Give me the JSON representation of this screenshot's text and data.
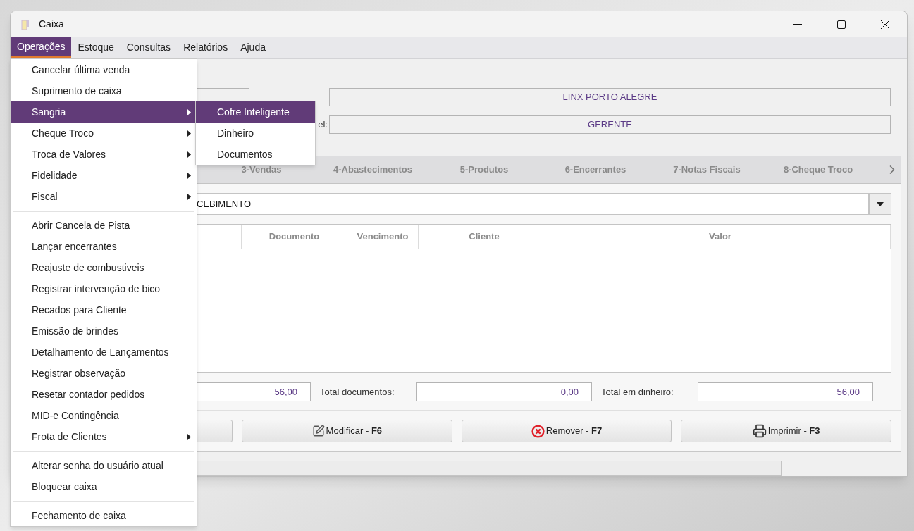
{
  "window": {
    "title": "Caixa"
  },
  "menubar": [
    {
      "label": "Operações",
      "selected": true
    },
    {
      "label": "Estoque",
      "selected": false
    },
    {
      "label": "Consultas",
      "selected": false
    },
    {
      "label": "Relatórios",
      "selected": false
    },
    {
      "label": "Ajuda",
      "selected": false
    }
  ],
  "header": {
    "empresa_value": "LINX PORTO ALEGRE",
    "responsavel_label": "el:",
    "responsavel_value": "GERENTE"
  },
  "tabs": [
    "3-Vendas",
    "4-Abastecimentos",
    "5-Produtos",
    "6-Encerrantes",
    "7-Notas Fiscais",
    "8-Cheque Troco"
  ],
  "combo": {
    "value": "CEBIMENTO"
  },
  "table": {
    "columns": [
      "Documento",
      "Vencimento",
      "Cliente",
      "Valor"
    ]
  },
  "totals": [
    {
      "value": "56,00"
    },
    {
      "label": "Total documentos:",
      "value": "0,00"
    },
    {
      "label": "Total em dinheiro:",
      "value": "56,00"
    }
  ],
  "buttons": [
    {
      "label": "Modificar - **F6**"
    },
    {
      "label": "Remover - **F7**"
    },
    {
      "label": "Imprimir - **F3**"
    }
  ],
  "menu": [
    {
      "kind": "item",
      "label": "Cancelar última venda",
      "submenu": false,
      "selected": false
    },
    {
      "kind": "item",
      "label": "Suprimento de caixa",
      "submenu": false,
      "selected": false
    },
    {
      "kind": "item",
      "label": "Sangria",
      "submenu": true,
      "selected": true
    },
    {
      "kind": "item",
      "label": "Cheque Troco",
      "submenu": true,
      "selected": false
    },
    {
      "kind": "item",
      "label": "Troca de Valores",
      "submenu": true,
      "selected": false
    },
    {
      "kind": "item",
      "label": "Fidelidade",
      "submenu": true,
      "selected": false
    },
    {
      "kind": "item",
      "label": "Fiscal",
      "submenu": true,
      "selected": false
    },
    {
      "kind": "separator"
    },
    {
      "kind": "item",
      "label": "Abrir Cancela de Pista",
      "submenu": false,
      "selected": false
    },
    {
      "kind": "item",
      "label": "Lançar encerrantes",
      "submenu": false,
      "selected": false
    },
    {
      "kind": "item",
      "label": "Reajuste de combustiveis",
      "submenu": false,
      "selected": false
    },
    {
      "kind": "item",
      "label": "Registrar intervenção de bico",
      "submenu": false,
      "selected": false
    },
    {
      "kind": "item",
      "label": "Recados para Cliente",
      "submenu": false,
      "selected": false
    },
    {
      "kind": "item",
      "label": "Emissão de brindes",
      "submenu": false,
      "selected": false
    },
    {
      "kind": "item",
      "label": "Detalhamento de Lançamentos",
      "submenu": false,
      "selected": false
    },
    {
      "kind": "item",
      "label": "Registrar observação",
      "submenu": false,
      "selected": false
    },
    {
      "kind": "item",
      "label": "Resetar contador pedidos",
      "submenu": false,
      "selected": false
    },
    {
      "kind": "item",
      "label": "MID-e Contingência",
      "submenu": false,
      "selected": false
    },
    {
      "kind": "item",
      "label": "Frota de Clientes",
      "submenu": true,
      "selected": false
    },
    {
      "kind": "separator"
    },
    {
      "kind": "item",
      "label": "Alterar senha do usuário atual",
      "submenu": false,
      "selected": false
    },
    {
      "kind": "item",
      "label": "Bloquear caixa",
      "submenu": false,
      "selected": false
    },
    {
      "kind": "separator"
    },
    {
      "kind": "item",
      "label": "Fechamento de caixa",
      "submenu": false,
      "selected": false
    }
  ],
  "submenu": [
    {
      "label": "Cofre Inteligente",
      "selected": true
    },
    {
      "label": "Dinheiro",
      "selected": false
    },
    {
      "label": "Documentos",
      "selected": false
    }
  ]
}
